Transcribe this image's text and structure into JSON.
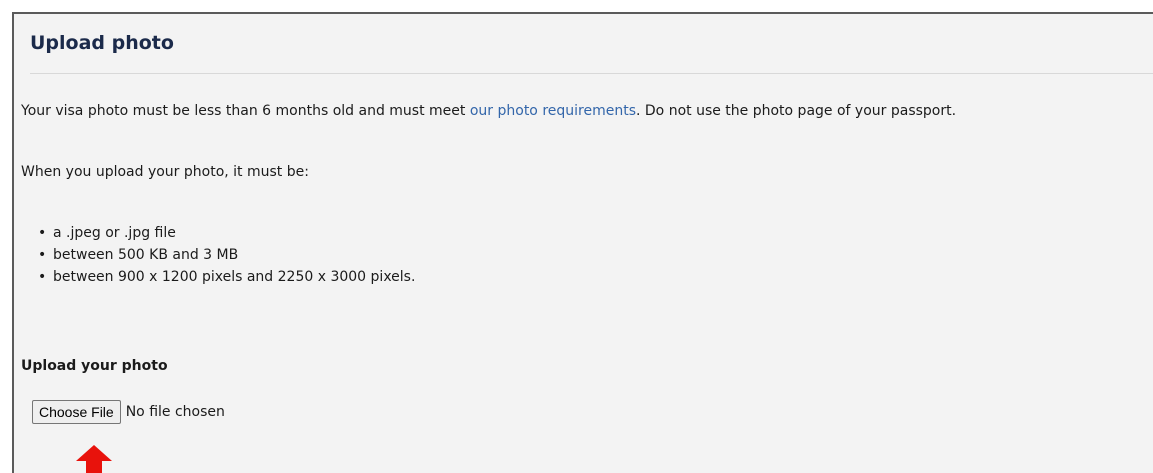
{
  "panel": {
    "title": "Upload photo"
  },
  "intro": {
    "text_before_link": "Your visa photo must be less than 6 months old and must meet ",
    "link_text": "our photo requirements",
    "text_after_link": ". Do not use the photo page of your passport."
  },
  "must_be_text": "When you upload your photo, it must be:",
  "requirements": [
    "a .jpeg or .jpg file",
    "between 500 KB and 3 MB",
    "between 900 x 1200 pixels and 2250 x 3000 pixels."
  ],
  "upload": {
    "label": "Upload your photo",
    "button_label": "Choose File",
    "status": "No file chosen"
  },
  "colors": {
    "arrow": "#e8120c",
    "link": "#3366aa",
    "panel_background": "#f3f3f3"
  },
  "icons": {
    "annotation_arrow": "red-up-arrow-icon"
  }
}
